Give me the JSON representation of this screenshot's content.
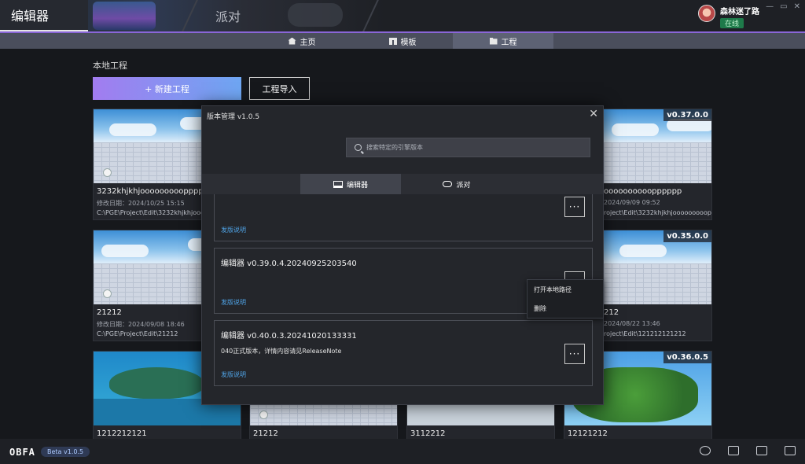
{
  "header": {
    "tab_editor": "编辑器",
    "tab_party": "派对",
    "window_controls": [
      "—",
      "▭",
      "✕"
    ],
    "user": {
      "name": "森林迷了路",
      "status": "在线"
    }
  },
  "nav": {
    "items": [
      {
        "label": "主页",
        "icon": "home-icon",
        "active": false
      },
      {
        "label": "模板",
        "icon": "template-icon",
        "active": false
      },
      {
        "label": "工程",
        "icon": "folder-icon",
        "active": true
      }
    ]
  },
  "main": {
    "section_title": "本地工程",
    "new_project": "+ 新建工程",
    "import_project": "工程导入",
    "cards": [
      {
        "title": "3232khjkhjoooooooooppppppp_b",
        "date": "修改日期：2024/10/25 15:15",
        "path": "C:\\PGE\\Project\\Edit\\3232khjkhjoooooooo",
        "version": ""
      },
      {
        "title": "oooooooooopppppp",
        "date": "2024/09/09 09:52",
        "path": "roject\\Edit\\3232khjkhjoooooooooppppppp",
        "version": "v0.37.0.0"
      },
      {
        "title": "21212",
        "date": "修改日期：2024/09/08 18:46",
        "path": "C:\\PGE\\Project\\Edit\\21212",
        "version": ""
      },
      {
        "title": "212",
        "date": "2024/08/22 13:46",
        "path": "roject\\Edit\\121212121212",
        "version": "v0.35.0.0"
      },
      {
        "title": "1212212121",
        "date": "",
        "path": "",
        "version": ""
      },
      {
        "title": "21212",
        "date": "",
        "path": "",
        "version": ""
      },
      {
        "title": "3112212",
        "date": "",
        "path": "",
        "version": ""
      },
      {
        "title": "12121212",
        "date": "",
        "path": "",
        "version": "v0.36.0.5"
      }
    ]
  },
  "modal": {
    "title": "版本管理 v1.0.5",
    "close": "✕",
    "search_placeholder": "搜索特定的引擎版本",
    "tabs": [
      {
        "label": "编辑器",
        "active": true
      },
      {
        "label": "派对",
        "active": false
      }
    ],
    "versions": [
      {
        "name": "",
        "desc": "",
        "link": "发版说明",
        "more": "···"
      },
      {
        "name": "编辑器 v0.39.0.4.20240925203540",
        "desc": "",
        "link": "发版说明",
        "more": "···"
      },
      {
        "name": "编辑器 v0.40.0.3.20241020133331",
        "desc": "040正式版本，详情内容请见ReleaseNote",
        "link": "发版说明",
        "more": "···"
      }
    ],
    "context_menu": [
      "打开本地路径",
      "删除"
    ]
  },
  "footer": {
    "logo": "OBFA",
    "beta": "Beta v1.0.5",
    "icons": [
      "planet-icon",
      "robot-icon",
      "book-icon",
      "feedback-icon"
    ]
  },
  "colors": {
    "accent_gradient_start": "#a27cf0",
    "accent_gradient_end": "#6ea6f2",
    "link": "#4fa3e6",
    "online": "#1e7a4a"
  }
}
